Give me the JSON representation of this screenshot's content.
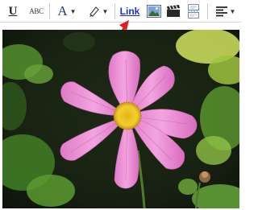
{
  "toolbar": {
    "underline_label": "U",
    "spellcheck_label": "ABC",
    "font_color_label": "A",
    "link_label": "Link"
  },
  "icons": {
    "underline": "underline-icon",
    "spellcheck": "spellcheck-icon",
    "font_color": "font-color-icon",
    "highlight": "highlight-pen-icon",
    "image": "insert-image-icon",
    "video": "insert-video-icon",
    "jump_break": "jump-break-icon",
    "align": "align-left-icon",
    "dropdown": "chevron-down-icon"
  },
  "colors": {
    "link_text": "#1a33b5",
    "annotation_arrow": "#e02020"
  }
}
